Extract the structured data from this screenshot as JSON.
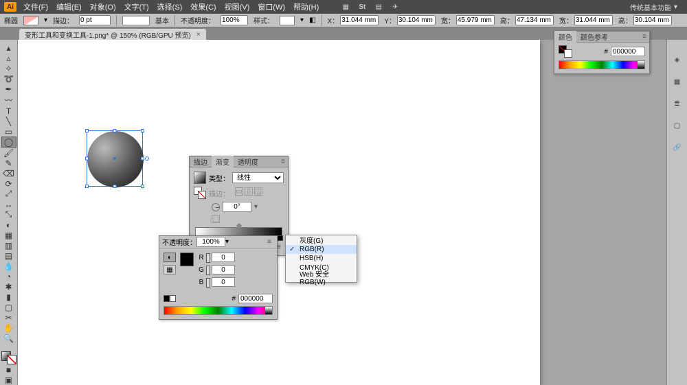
{
  "app": {
    "logo": "Ai"
  },
  "menubar": {
    "items": [
      "文件(F)",
      "编辑(E)",
      "对象(O)",
      "文字(T)",
      "选择(S)",
      "效果(C)",
      "视图(V)",
      "窗口(W)",
      "帮助(H)"
    ],
    "workspace_label": "传统基本功能"
  },
  "optbar": {
    "shape_label": "椭圆",
    "stroke_label": "描边：",
    "stroke_weight": "0 pt",
    "style_label": "基本",
    "opacity_label": "不透明度：",
    "opacity_value": "100%",
    "style2_label": "样式：",
    "x_label": "X：",
    "x_value": "31.044 mm",
    "y_label": "Y：",
    "y_value": "30.104 mm",
    "w_label": "宽：",
    "w_value": "45.979 mm",
    "h_label": "高：",
    "h_value": "47.134 mm",
    "w2_label": "宽：",
    "w2_value": "31.044 mm",
    "h2_label": "高：",
    "h2_value": "30.104 mm"
  },
  "doc_tab": {
    "title": "变形工具和变换工具-1.png* @ 150% (RGB/GPU 预览)"
  },
  "color_dock": {
    "tabs": [
      "颜色",
      "颜色参考"
    ],
    "hex": "000000"
  },
  "grad_panel": {
    "tabs": [
      "描边",
      "渐变",
      "透明度"
    ],
    "type_label": "类型：",
    "type_value": "线性",
    "stroke_label": "描边：",
    "angle_label": "Δ",
    "angle_value": "0°"
  },
  "picker_panel": {
    "opacity_label": "不透明度：",
    "opacity_value": "100%",
    "channels": {
      "R": "0",
      "G": "0",
      "B": "0"
    },
    "hex": "000000"
  },
  "ctx_menu": {
    "items": [
      "灰度(G)",
      "RGB(R)",
      "HSB(H)",
      "CMYK(C)",
      "Web 安全 RGB(W)"
    ],
    "checked_index": 1,
    "hover_index": 1
  }
}
